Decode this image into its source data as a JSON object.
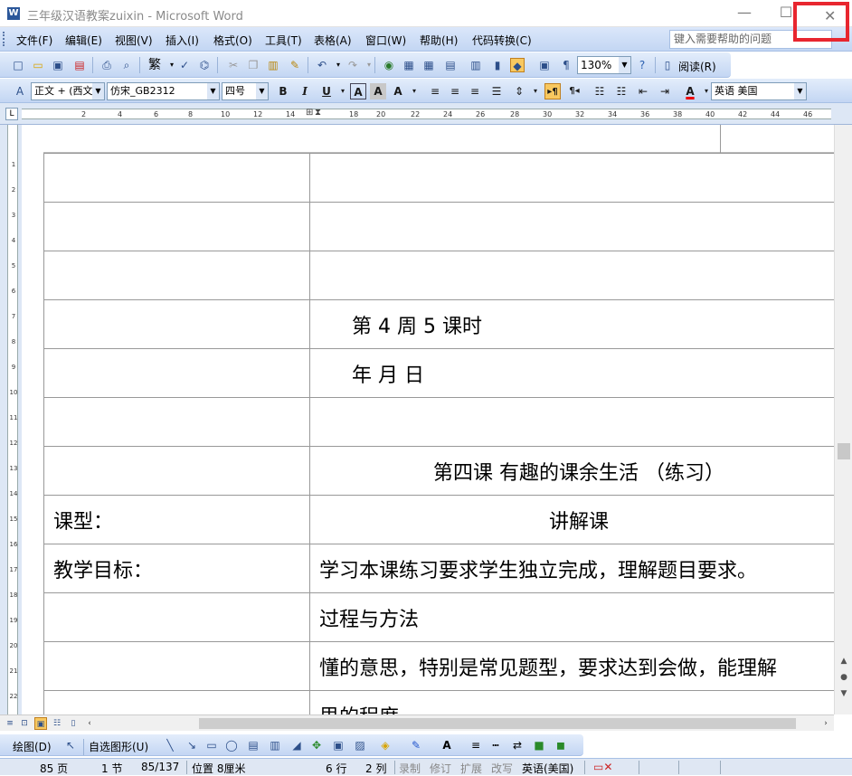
{
  "window": {
    "title": "三年级汉语教案zuixin - Microsoft Word",
    "app_icon": "W",
    "min": "—",
    "max": "☐",
    "close": "✕"
  },
  "menubar": {
    "items": [
      "文件(F)",
      "编辑(E)",
      "视图(V)",
      "插入(I)",
      "格式(O)",
      "工具(T)",
      "表格(A)",
      "窗口(W)",
      "帮助(H)",
      "代码转换(C)"
    ],
    "help_placeholder": "键入需要帮助的问题"
  },
  "toolbar_standard": {
    "zoom": "130%",
    "read_label": "阅读(R)",
    "trad_label": "繁"
  },
  "toolbar_format": {
    "style": "正文 + (西文)",
    "font": "仿宋_GB2312",
    "size": "四号",
    "language": "英语 美国"
  },
  "ruler": {
    "numbers": [
      "2",
      "4",
      "6",
      "8",
      "10",
      "12",
      "14",
      "18",
      "20",
      "22",
      "24",
      "26",
      "28",
      "30",
      "32",
      "34",
      "36",
      "38",
      "40",
      "42",
      "44",
      "46"
    ]
  },
  "vruler": {
    "numbers": [
      "1",
      "2",
      "3",
      "4",
      "5",
      "6",
      "7",
      "8",
      "9",
      "10",
      "11",
      "12",
      "13",
      "14",
      "15",
      "16",
      "17",
      "18",
      "19",
      "20",
      "21",
      "22"
    ]
  },
  "document": {
    "rows": [
      {
        "c1": "",
        "c2": ""
      },
      {
        "c1": "",
        "c2": ""
      },
      {
        "c1": "",
        "c2": ""
      },
      {
        "c1": "",
        "c2": "第 4 周 5 课时"
      },
      {
        "c1": "",
        "c2": "年    月      日"
      },
      {
        "c1": "",
        "c2": ""
      },
      {
        "c1": "",
        "c2": "第四课  有趣的课余生活    （练习）"
      },
      {
        "c1": "课型：",
        "c2": "讲解课"
      },
      {
        "c1": "教学目标：",
        "c2": "学习本课练习要求学生独立完成，理解题目要求。"
      },
      {
        "c1": "",
        "c2": "过程与方法"
      },
      {
        "c1": "",
        "c2": "懂的意思，特别是常见题型，要求达到会做，能理解"
      },
      {
        "c1": "",
        "c2": "思的程度"
      }
    ]
  },
  "drawbar": {
    "draw_label": "绘图(D)",
    "autoshape_label": "自选图形(U)"
  },
  "statusbar": {
    "page": "85 页",
    "section": "1 节",
    "pages": "85/137",
    "position": "位置 8厘米",
    "line": "6 行",
    "column": "2 列",
    "rec": "录制",
    "trk": "修订",
    "ext": "扩展",
    "ovr": "改写",
    "lang": "英语(美国)"
  }
}
